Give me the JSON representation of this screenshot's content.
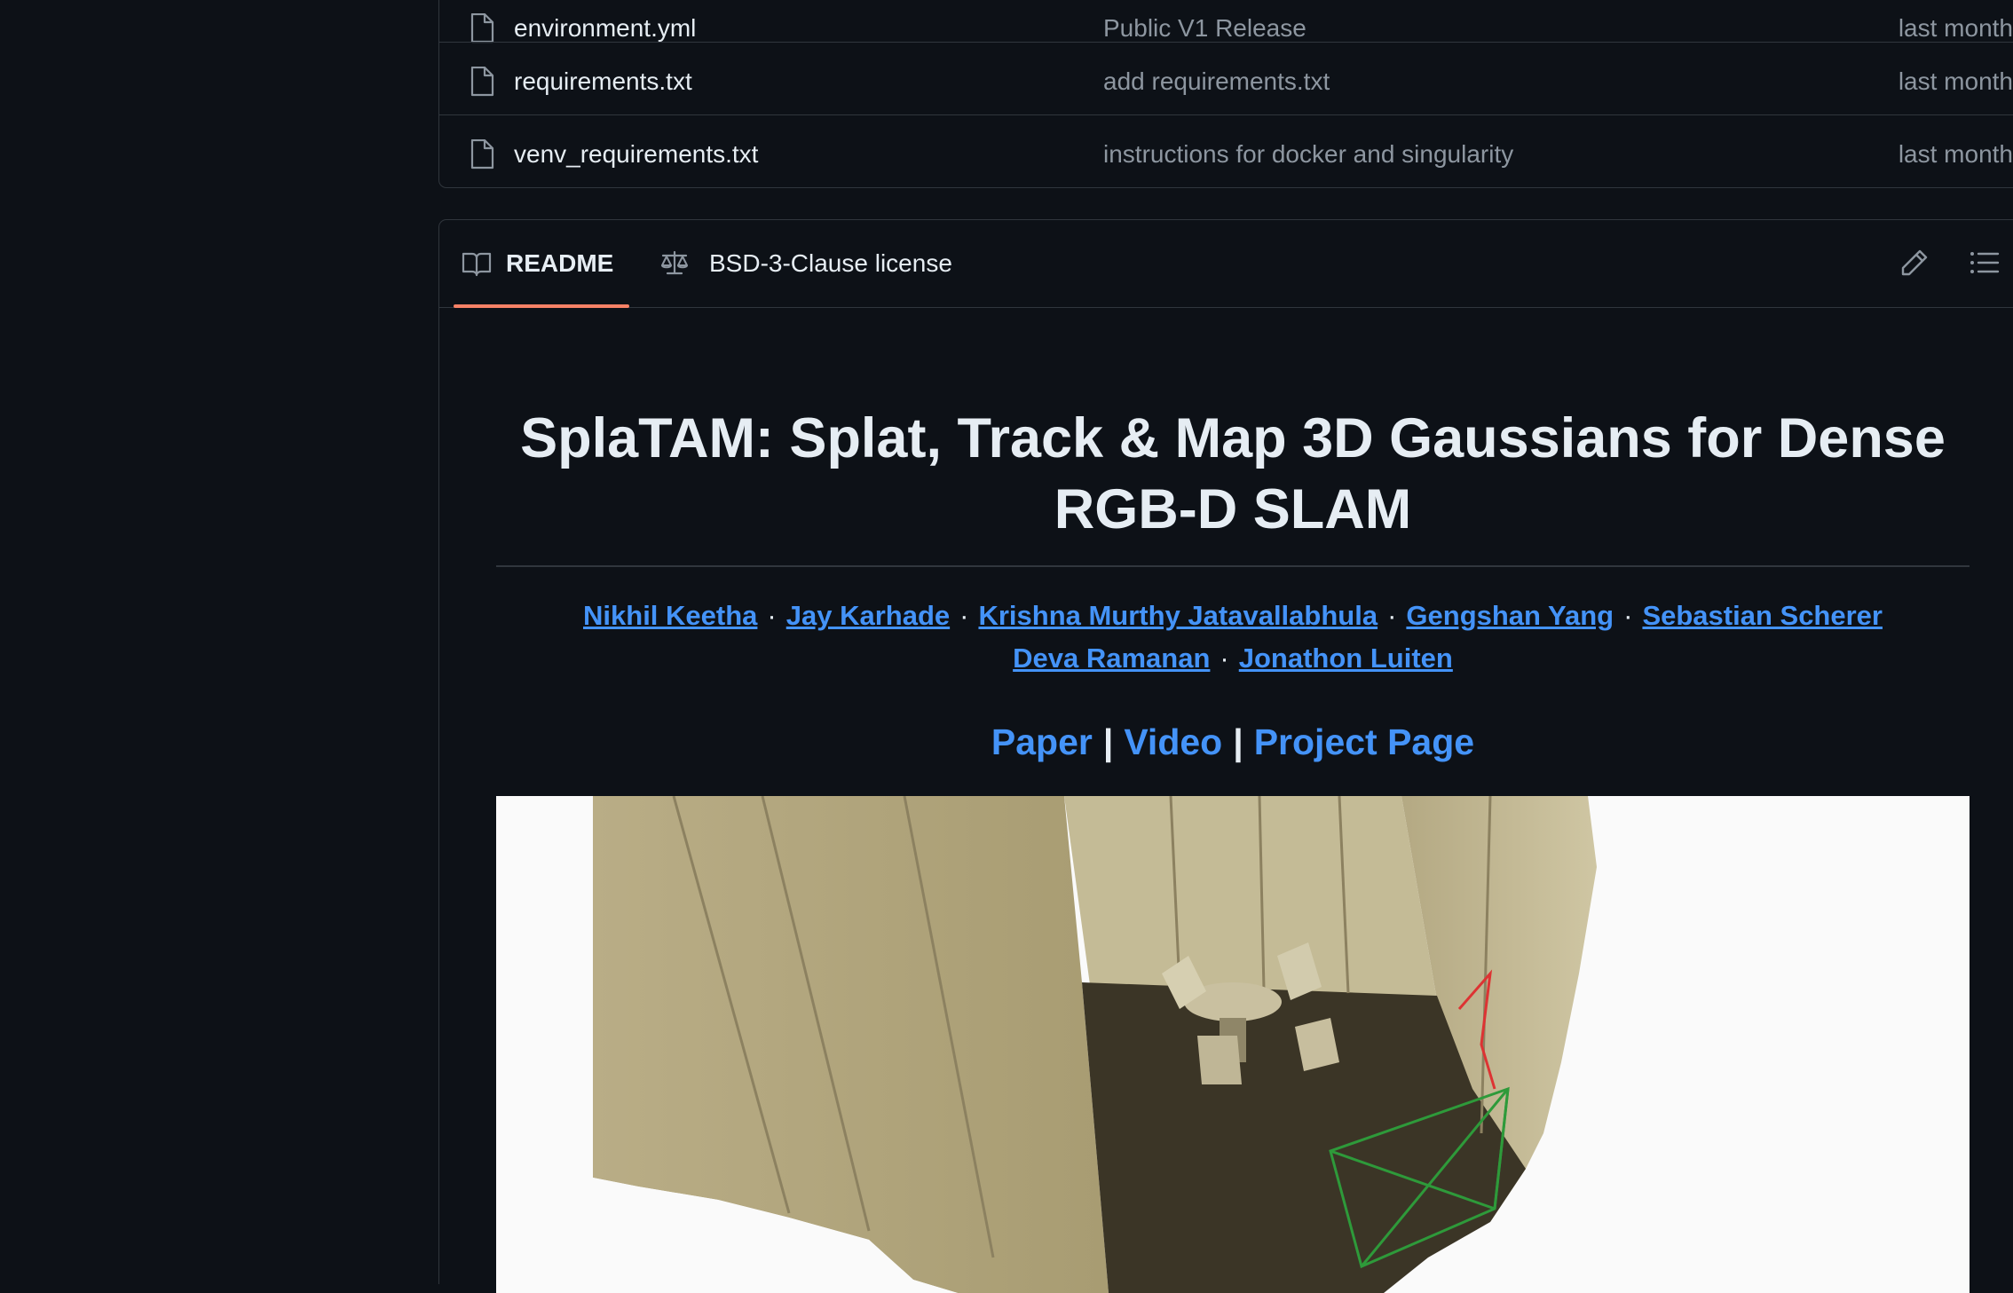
{
  "files": [
    {
      "name": "environment.yml",
      "message": "Public V1 Release",
      "date": "last month"
    },
    {
      "name": "requirements.txt",
      "message": "add requirements.txt",
      "date": "last month"
    },
    {
      "name": "venv_requirements.txt",
      "message": "instructions for docker and singularity",
      "date": "last month"
    }
  ],
  "readme_tabs": {
    "readme": "README",
    "license": "BSD-3-Clause license"
  },
  "readme": {
    "title": "SplaTAM: Splat, Track & Map 3D Gaussians for Dense RGB-D SLAM",
    "authors_line1": [
      "Nikhil Keetha",
      "Jay Karhade",
      "Krishna Murthy Jatavallabhula",
      "Gengshan Yang",
      "Sebastian Scherer"
    ],
    "authors_line2": [
      "Deva Ramanan",
      "Jonathon Luiten"
    ],
    "separator": "·",
    "links": [
      "Paper",
      "Video",
      "Project Page"
    ],
    "link_separator": "|"
  },
  "colors": {
    "background": "#0d1117",
    "border": "#30363d",
    "link": "#4493f8",
    "muted": "#8d96a0",
    "tab_underline": "#f78166"
  },
  "icons": [
    "file-icon",
    "book-icon",
    "law-icon",
    "pencil-icon",
    "list-icon"
  ]
}
